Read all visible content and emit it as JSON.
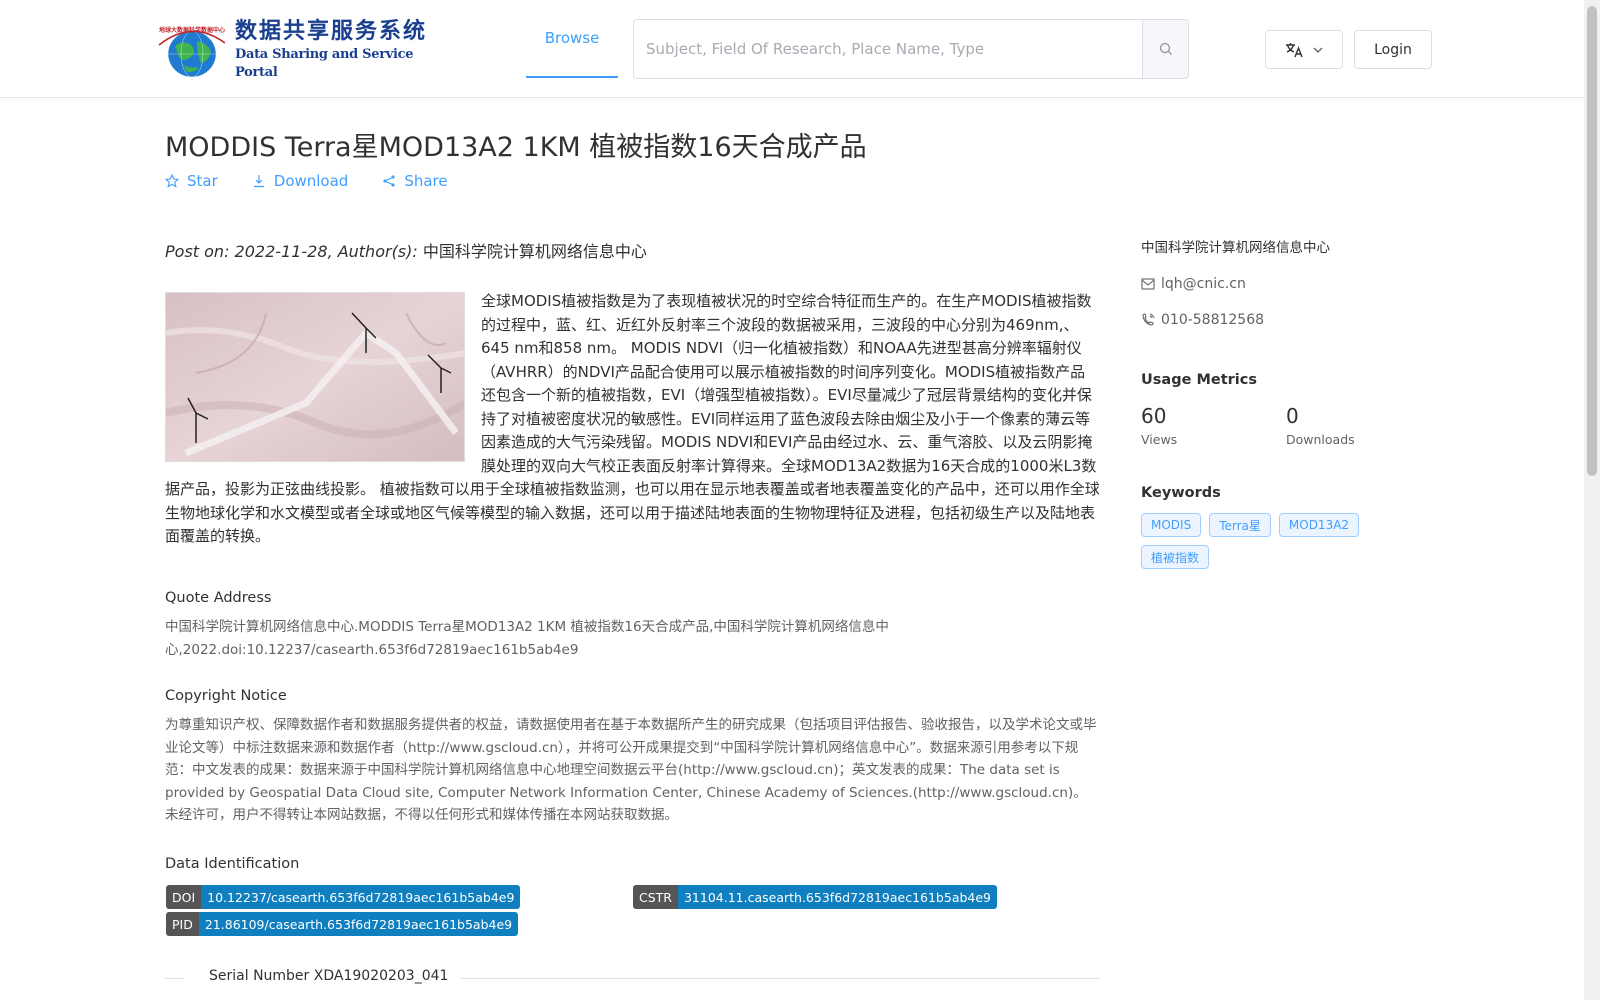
{
  "header": {
    "logo_cn": "数据共享服务系统",
    "logo_en": "Data Sharing and Service Portal",
    "logo_small": "Big Earth Data Center,CAS",
    "nav_browse": "Browse",
    "search_placeholder": "Subject, Field Of Research, Place Name, Type",
    "login_label": "Login"
  },
  "dataset": {
    "title": "MODDIS Terra星MOD13A2 1KM 植被指数16天合成产品",
    "actions": {
      "star": "Star",
      "download": "Download",
      "share": "Share"
    },
    "post_prefix": "Post on: 2022-11-28, Author(s): ",
    "author": "中国科学院计算机网络信息中心",
    "description": "全球MODIS植被指数是为了表现植被状况的时空综合特征而生产的。在生产MODIS植被指数的过程中，蓝、红、近红外反射率三个波段的数据被采用，三波段的中心分别为469nm,、645 nm和858 nm。 MODIS NDVI（归一化植被指数）和NOAA先进型甚高分辨率辐射仪（AVHRR）的NDVI产品配合使用可以展示植被指数的时间序列变化。MODIS植被指数产品还包含一个新的植被指数，EVI（增强型植被指数）。EVI尽量减少了冠层背景结构的变化并保持了对植被密度状况的敏感性。EVI同样运用了蓝色波段去除由烟尘及小于一个像素的薄云等因素造成的大气污染残留。MODIS NDVI和EVI产品由经过水、云、重气溶胶、以及云阴影掩膜处理的双向大气校正表面反射率计算得来。全球MOD13A2数据为16天合成的1000米L3数据产品，投影为正弦曲线投影。 植被指数可以用于全球植被指数监测，也可以用在显示地表覆盖或者地表覆盖变化的产品中，还可以用作全球生物地球化学和水文模型或者全球或地区气候等模型的输入数据，还可以用于描述陆地表面的生物物理特征及进程，包括初级生产以及陆地表面覆盖的转换。"
  },
  "quote": {
    "title": "Quote Address",
    "text": "中国科学院计算机网络信息中心.MODDIS Terra星MOD13A2 1KM 植被指数16天合成产品,中国科学院计算机网络信息中心,2022.doi:10.12237/casearth.653f6d72819aec161b5ab4e9"
  },
  "copyright": {
    "title": "Copyright Notice",
    "text": "为尊重知识产权、保障数据作者和数据服务提供者的权益，请数据使用者在基于本数据所产生的研究成果（包括项目评估报告、验收报告，以及学术论文或毕业论文等）中标注数据来源和数据作者（http://www.gscloud.cn），并将可公开成果提交到“中国科学院计算机网络信息中心”。数据来源引用参考以下规范：中文发表的成果：数据来源于中国科学院计算机网络信息中心地理空间数据云平台(http://www.gscloud.cn)；英文发表的成果：The data set is provided by Geospatial Data Cloud site, Computer Network Information Center, Chinese Academy of Sciences.(http://www.gscloud.cn)。未经许可，用户不得转让本网站数据，不得以任何形式和媒体传播在本网站获取数据。"
  },
  "identification": {
    "title": "Data Identification",
    "doi_label": "DOI",
    "doi_value": "10.12237/casearth.653f6d72819aec161b5ab4e9",
    "cstr_label": "CSTR",
    "cstr_value": "31104.11.casearth.653f6d72819aec161b5ab4e9",
    "pid_label": "PID",
    "pid_value": "21.86109/casearth.653f6d72819aec161b5ab4e9"
  },
  "serial": {
    "text": "Serial Number XDA19020203_041"
  },
  "sidebar": {
    "org": "中国科学院计算机网络信息中心",
    "email": "lqh@cnic.cn",
    "phone": "010-58812568",
    "metrics_title": "Usage Metrics",
    "views_value": "60",
    "views_label": "Views",
    "downloads_value": "0",
    "downloads_label": "Downloads",
    "keywords_title": "Keywords",
    "keywords": [
      "MODIS",
      "Terra星",
      "MOD13A2",
      "植被指数"
    ]
  },
  "colors": {
    "accent": "#409eff",
    "badge_blue": "#0f7fbf",
    "badge_gray": "#555555"
  }
}
